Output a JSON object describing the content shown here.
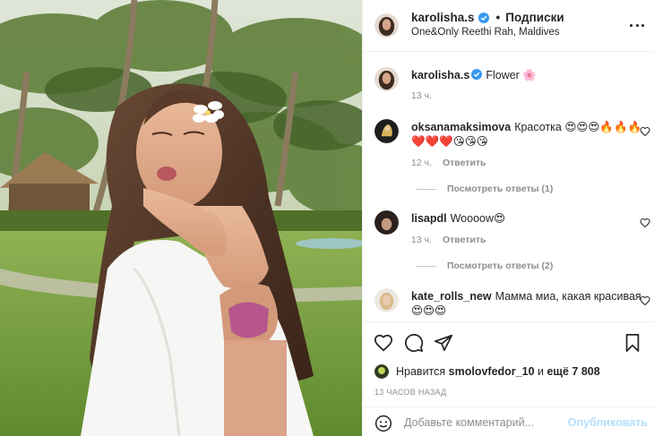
{
  "post": {
    "author": {
      "username": "karolisha.s",
      "verified": true,
      "follow_dot": "•",
      "follow_label": "Подписки",
      "location": "One&Only Reethi Rah, Maldives"
    },
    "caption": {
      "username": "karolisha.s",
      "text": "Flower 🌸",
      "time": "13 ч."
    }
  },
  "comments": [
    {
      "username": "oksanamaksimova",
      "text": "Красотка 😍😍😍🔥🔥🔥❤️❤️❤️😘😘😘",
      "time": "12 ч.",
      "reply_label": "Ответить",
      "view_replies": "Посмотреть ответы (1)"
    },
    {
      "username": "lisapdl",
      "text": "Woooow😍",
      "time": "13 ч.",
      "reply_label": "Ответить",
      "view_replies": "Посмотреть ответы (2)"
    },
    {
      "username": "kate_rolls_new",
      "text": "Мамма миа, какая красивая 😍😍😍"
    }
  ],
  "likes": {
    "prefix": "Нравится",
    "user": "smolovfedor_10",
    "middle": "и",
    "others": "ещё 7 808"
  },
  "timestamp": "13 ЧАСОВ НАЗАД",
  "composer": {
    "placeholder": "Добавьте комментарий...",
    "publish_label": "Опубликовать"
  },
  "icons": {
    "like": "heart-outline-icon",
    "comment": "speech-bubble-icon",
    "share": "paper-plane-icon",
    "save": "bookmark-icon",
    "more": "three-dots-icon",
    "emoji": "smiley-face-icon",
    "verified": "verified-badge-icon"
  },
  "colors": {
    "verified": "#3897f0",
    "publish_disabled": "#b2dffc",
    "secondary_text": "#8e8e8e",
    "border": "#efefef"
  }
}
